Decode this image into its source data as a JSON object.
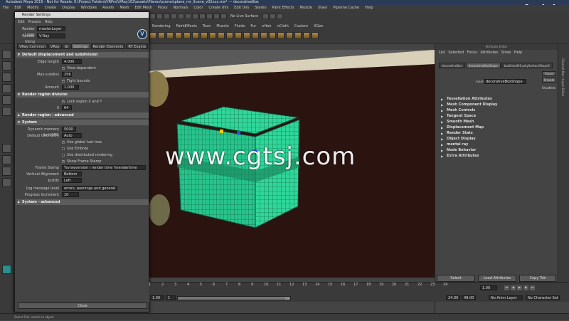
{
  "window": {
    "title": "Autodesk Maya 2015 - Not for Resale: E:\\Project Folders\\VRPnd\\VRay102\\assets\\Planes\\scenes\\plane_mr_Scene_v02xxx.ma*  ---  decorativeBox"
  },
  "menubar": {
    "items": [
      "File",
      "Edit",
      "Modify",
      "Create",
      "Display",
      "Windows",
      "Assets",
      "Mesh",
      "Edit Mesh",
      "Proxy",
      "Normals",
      "Color",
      "Create UVs",
      "Edit UVs",
      "Stereo",
      "Paint Effects",
      "Muscle",
      "XGen",
      "Pipeline Cache",
      "Help"
    ]
  },
  "status_line": {
    "no_live_surface": "No Live Surface"
  },
  "shelf": {
    "tabs": [
      "Rendering",
      "PaintEffects",
      "Toon",
      "Muscle",
      "Fluids",
      "Fur",
      "nHair",
      "nCloth",
      "Custom",
      "XGen"
    ]
  },
  "render_settings": {
    "title": "Render Settings",
    "menu": [
      "Edit",
      "Presets",
      "Help"
    ],
    "render_layer_label": "Render Layer",
    "render_layer_value": "masterLayer",
    "render_using_label": "Render Using",
    "render_using_value": "V-Ray",
    "tabs": [
      "VRay Common",
      "VRay",
      "GI",
      "Settings",
      "Render Elements",
      "RT Engine"
    ],
    "sections": {
      "displacement": "Default displacement and subdivision",
      "region": "Render region division",
      "region_adv": "Render region - advanced",
      "system": "System",
      "system_adv": "System - advanced"
    },
    "fields": {
      "edge_length_label": "Edge length",
      "edge_length_value": "4.000",
      "view_dependent": "View-dependent",
      "max_subdivs_label": "Max subdivs",
      "max_subdivs_value": "256",
      "tight_bounds": "Tight bounds",
      "amount_label": "Amount",
      "amount_value": "1.000",
      "lock_region": "Lock region X and Y",
      "x_label": "X",
      "x_value": "64",
      "dyn_mem_label": "Dynamic memory limit(MB)",
      "dyn_mem_value": "5000",
      "default_geo_label": "Default Geometry",
      "default_geo_value": "Auto",
      "use_global_hair": "Use global hair tree",
      "use_embree": "Use Embree",
      "use_distributed": "Use distributed rendering",
      "show_frame_stamp": "Show Frame Stamp",
      "frame_stamp_label": "Frame Stamp",
      "frame_stamp_value": "%vrayversion | render time %rendertime",
      "vert_align_label": "Vertical Alignment",
      "vert_align_value": "Bottom",
      "justify_label": "Justify",
      "justify_value": "Left",
      "log_level_label": "Log message level",
      "log_level_value": "errors, warnings and general info",
      "progress_label": "Progress Increment",
      "progress_value": "10"
    },
    "close_label": "Close"
  },
  "attribute_editor": {
    "title": "Attribute Editor",
    "menu": [
      "List",
      "Selected",
      "Focus",
      "Attributes",
      "Show",
      "Help"
    ],
    "tabs": [
      "decorativeBox",
      "decorativeBoxShape",
      "boxDetail01:polySurfaceShape1"
    ],
    "focus_label": "Focus",
    "presets_label": "Presets",
    "show_label": "Show",
    "hide_label": "Hide",
    "mesh_label": "mesh:",
    "mesh_value": "decorativeBoxShape",
    "sections": [
      "Tessellation Attributes",
      "Mesh Component Display",
      "Mesh Controls",
      "Tangent Space",
      "Smooth Mesh",
      "Displacement Map",
      "Render Stats",
      "Object Display",
      "mental ray",
      "Node Behavior",
      "Extra Attributes"
    ],
    "buttons": {
      "select": "Select",
      "load": "Load Attributes",
      "copy": "Copy Tab"
    },
    "side_tab": "Channel Box / Layer Editor"
  },
  "timeline": {
    "ticks": [
      "1",
      "2",
      "3",
      "4",
      "5",
      "6",
      "7",
      "8",
      "9",
      "10",
      "11",
      "12",
      "13",
      "14",
      "15",
      "16",
      "17",
      "18",
      "19",
      "20",
      "21",
      "22",
      "23",
      "24"
    ],
    "current_frame": "1.00",
    "range_start": "1.00",
    "range_inner_start": "1",
    "range_end": "24",
    "range_end_value": "24.00",
    "range_max": "48.00",
    "anim_layer": "No Anim Layer",
    "char_set": "No Character Set"
  },
  "help_line": "Select Tool: select an object",
  "watermark": "www.cgtsj.com",
  "logo": {
    "text": "fxphd",
    "sub": "com"
  }
}
